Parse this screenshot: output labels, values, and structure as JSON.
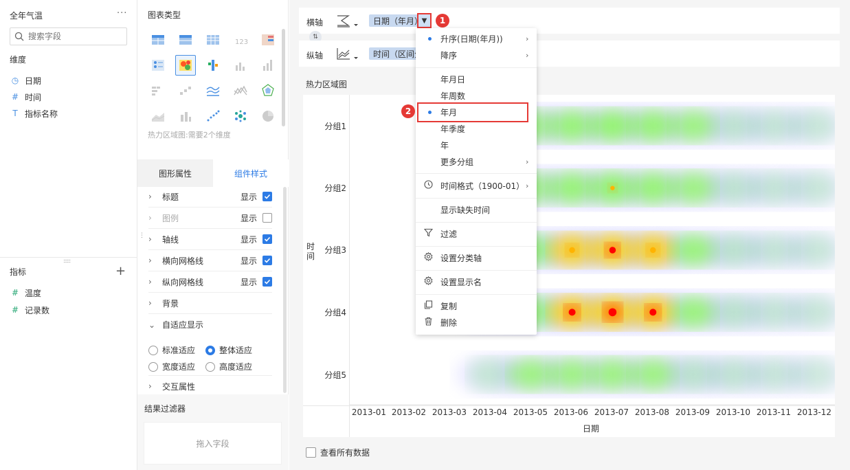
{
  "left": {
    "title": "全年气温",
    "more": "···",
    "search_placeholder": "搜索字段",
    "dimensions_label": "维度",
    "dimensions": [
      {
        "icon": "clock-icon",
        "glyph": "◷",
        "label": "日期"
      },
      {
        "icon": "hash-icon",
        "glyph": "#",
        "label": "时间"
      },
      {
        "icon": "text-icon",
        "glyph": "T",
        "label": "指标名称"
      }
    ],
    "metrics_label": "指标",
    "metrics": [
      {
        "icon": "hash-icon",
        "glyph": "#",
        "label": "温度"
      },
      {
        "icon": "hash-star-icon",
        "glyph": "#",
        "label": "记录数"
      }
    ]
  },
  "mid": {
    "chart_types_label": "图表类型",
    "chart_type_note": "热力区域图:需要2个维度",
    "tabs": [
      "图形属性",
      "组件样式"
    ],
    "props": [
      {
        "label": "标题",
        "show": "显示",
        "checked": true
      },
      {
        "label": "图例",
        "show": "显示",
        "checked": false
      },
      {
        "label": "轴线",
        "show": "显示",
        "checked": true
      },
      {
        "label": "横向网格线",
        "show": "显示",
        "checked": true
      },
      {
        "label": "纵向网格线",
        "show": "显示",
        "checked": true
      },
      {
        "label": "背景"
      },
      {
        "label": "自适应显示"
      }
    ],
    "fit_options": [
      "标准适应",
      "整体适应",
      "宽度适应",
      "高度适应"
    ],
    "fit_selected": "整体适应",
    "interact_label": "交互属性",
    "result_filter_label": "结果过滤器",
    "drop_field": "拖入字段"
  },
  "axes": {
    "x_label": "横轴",
    "x_pill": "日期（年月）",
    "y_label": "纵轴",
    "y_pill": "时间（区间分"
  },
  "badges": [
    "1",
    "2"
  ],
  "menu": {
    "items": [
      {
        "label": "升序(日期(年月))",
        "dot": true,
        "arrow": true
      },
      {
        "label": "降序",
        "arrow": true
      },
      {
        "label": "年月日"
      },
      {
        "label": "年周数"
      },
      {
        "label": "年月",
        "dot": true
      },
      {
        "label": "年季度"
      },
      {
        "label": "年"
      },
      {
        "label": "更多分组",
        "arrow": true
      },
      {
        "label": "时间格式（1900-01）",
        "icon": "clock-icon",
        "arrow": true
      },
      {
        "label": "显示缺失时间"
      },
      {
        "label": "过滤",
        "icon": "filter-icon"
      },
      {
        "label": "设置分类轴",
        "icon": "gear-icon"
      },
      {
        "label": "设置显示名",
        "icon": "gear-icon"
      },
      {
        "label": "复制",
        "icon": "copy-icon"
      },
      {
        "label": "删除",
        "icon": "trash-icon"
      }
    ]
  },
  "chart_data": {
    "type": "heatmap",
    "title": "热力区域图",
    "xlabel": "日期",
    "ylabel": "时间",
    "x": [
      "2013-01",
      "2013-02",
      "2013-03",
      "2013-04",
      "2013-05",
      "2013-06",
      "2013-07",
      "2013-08",
      "2013-09",
      "2013-10",
      "2013-11",
      "2013-12"
    ],
    "y": [
      "分组1",
      "分组2",
      "分组3",
      "分组4",
      "分组5"
    ],
    "intensity": [
      [
        0,
        0,
        0,
        0.2,
        0.45,
        0.55,
        0.6,
        0.55,
        0.45,
        0.3,
        0.2,
        0.15
      ],
      [
        0,
        0,
        0,
        0.2,
        0.45,
        0.55,
        0.62,
        0.55,
        0.45,
        0.3,
        0.2,
        0.15
      ],
      [
        0,
        0,
        0,
        0.25,
        0.5,
        0.75,
        0.82,
        0.75,
        0.5,
        0.35,
        0.2,
        0.15
      ],
      [
        0,
        0,
        0,
        0.3,
        0.5,
        0.85,
        0.95,
        0.85,
        0.5,
        0.35,
        0.2,
        0.15
      ],
      [
        0,
        0,
        0,
        0.2,
        0.45,
        0.45,
        0.45,
        0.45,
        0.35,
        0.25,
        0.15,
        0.05
      ]
    ],
    "colors": [
      "#c8c8ff",
      "#8ce3a0",
      "#7bff3c",
      "#ffff00",
      "#ff0000"
    ]
  },
  "show_all_data": "查看所有数据"
}
